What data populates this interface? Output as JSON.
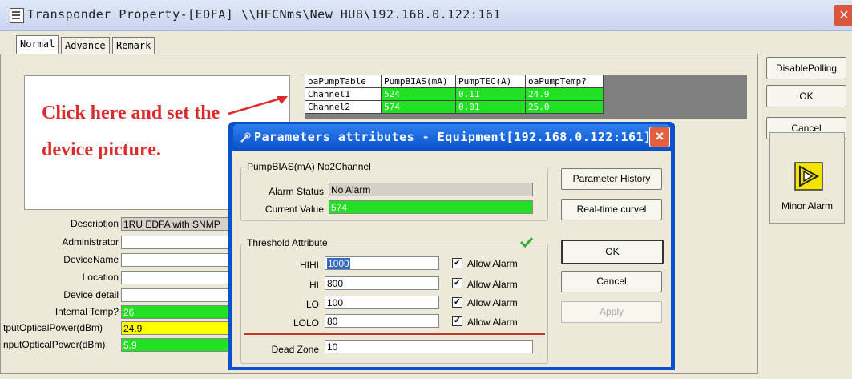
{
  "window": {
    "title": "Transponder Property-[EDFA] \\\\HFCNms\\New HUB\\192.168.0.122:161",
    "close_glyph": "×"
  },
  "tabs": [
    {
      "label": "Normal",
      "active": true
    },
    {
      "label": "Advance",
      "active": false
    },
    {
      "label": "Remark",
      "active": false
    }
  ],
  "annotation": {
    "line1": "Click here and set the",
    "line2": "device picture."
  },
  "pump_table": {
    "headers": [
      "oaPumpTable",
      "PumpBIAS(mA)",
      "PumpTEC(A)",
      "oaPumpTemp?"
    ],
    "rows": [
      [
        "Channel1",
        "524",
        "0.11",
        "24.9"
      ],
      [
        "Channel2",
        "574",
        "0.01",
        "25.0"
      ]
    ]
  },
  "properties": [
    {
      "label": "Description",
      "value": "1RU EDFA with SNMP",
      "style": "grey"
    },
    {
      "label": "Administrator",
      "value": "",
      "style": "white"
    },
    {
      "label": "DeviceName",
      "value": "",
      "style": "white"
    },
    {
      "label": "Location",
      "value": "",
      "style": "white"
    },
    {
      "label": "Device detail",
      "value": "",
      "style": "white"
    },
    {
      "label": "Internal Temp?",
      "value": "26",
      "style": "green"
    },
    {
      "label": "tputOpticalPower(dBm)",
      "value": "24.9",
      "style": "yellow"
    },
    {
      "label": "nputOpticalPower(dBm)",
      "value": "5.9",
      "style": "green"
    }
  ],
  "right_panel": {
    "disable_polling": "DisablePolling",
    "ok": "OK",
    "cancel": "Cancel",
    "alarm_label": "Minor Alarm",
    "alarm_icon": "minor-alarm-icon"
  },
  "dialog": {
    "title": "Parameters attributes - Equipment[192.168.0.122:161]",
    "close_glyph": "×",
    "group1_title": "PumpBIAS(mA) No2Channel",
    "alarm_status_label": "Alarm Status",
    "alarm_status_value": "No Alarm",
    "current_value_label": "Current Value",
    "current_value": "574",
    "group2_title": "Threshold Attribute",
    "check_icon": "green-check-icon",
    "thresholds": [
      {
        "label": "HIHI",
        "value": "1000",
        "allow": "Allow Alarm",
        "checked": true
      },
      {
        "label": "HI",
        "value": "800",
        "allow": "Allow Alarm",
        "checked": true
      },
      {
        "label": "LO",
        "value": "100",
        "allow": "Allow Alarm",
        "checked": true
      },
      {
        "label": "LOLO",
        "value": "80",
        "allow": "Allow Alarm",
        "checked": true
      }
    ],
    "dead_zone_label": "Dead Zone",
    "dead_zone_value": "10",
    "buttons": {
      "history": "Parameter History",
      "curve": "Real-time curvel",
      "ok": "OK",
      "cancel": "Cancel",
      "apply": "Apply"
    },
    "colors": {
      "title_bar": "#0a52cc",
      "divider": "#c0392b",
      "value_green": "#22e022"
    }
  }
}
